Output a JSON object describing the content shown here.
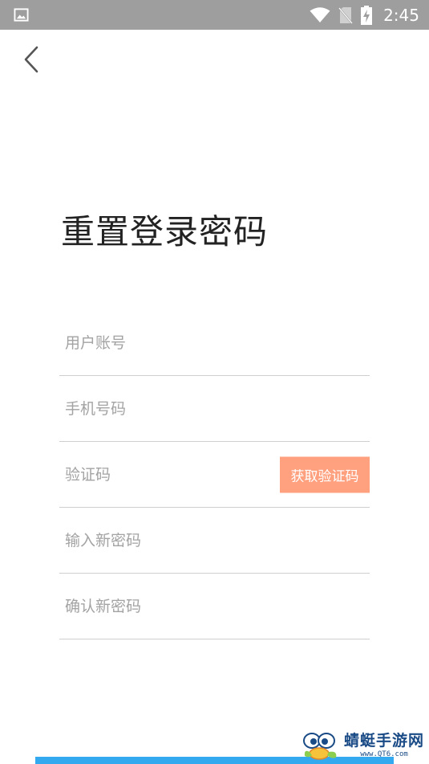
{
  "status_bar": {
    "time": "2:45",
    "left_icon": "image-icon",
    "icons": [
      "wifi-icon",
      "no-sim-icon",
      "battery-charging-icon"
    ]
  },
  "nav": {
    "back_icon": "chevron-left-icon"
  },
  "page": {
    "title": "重置登录密码"
  },
  "form": {
    "account_placeholder": "用户账号",
    "phone_placeholder": "手机号码",
    "code_placeholder": "验证码",
    "get_code_label": "获取验证码",
    "new_password_placeholder": "输入新密码",
    "confirm_password_placeholder": "确认新密码"
  },
  "colors": {
    "status_bar": "#9e9e9e",
    "accent_button": "#ffa07f",
    "submit_button": "#33aaf0",
    "title": "#222222",
    "placeholder": "#a3a3a3",
    "divider": "#cfcfcf"
  },
  "watermark": {
    "name": "蜻蜓手游网",
    "url": "www.QT6.com"
  }
}
